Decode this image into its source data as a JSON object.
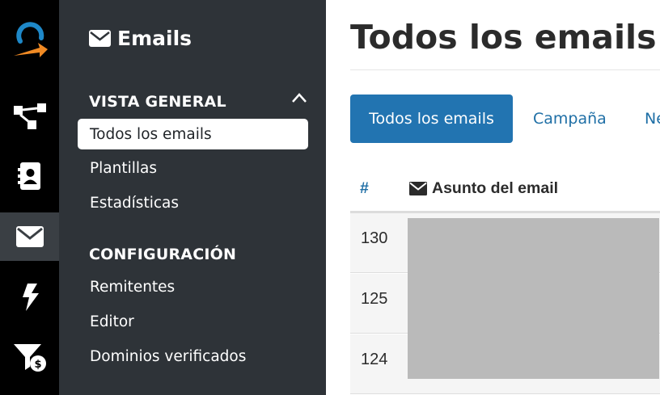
{
  "rail": {
    "items": [
      {
        "name": "logo-icon",
        "active": false
      },
      {
        "name": "workflow-icon",
        "active": false
      },
      {
        "name": "contacts-icon",
        "active": false
      },
      {
        "name": "envelope-icon",
        "active": true
      },
      {
        "name": "lightning-icon",
        "active": false
      },
      {
        "name": "funnel-dollar-icon",
        "active": false
      }
    ],
    "logo_colors": {
      "ring": "#1e88c8",
      "arrow": "#f08a24"
    }
  },
  "sidebar": {
    "title": "Emails",
    "title_icon": "envelope-icon",
    "sections": [
      {
        "label": "VISTA GENERAL",
        "collapse_icon": "chevron-up-icon",
        "items": [
          {
            "label": "Todos los emails",
            "active": true
          },
          {
            "label": "Plantillas",
            "active": false
          },
          {
            "label": "Estadísticas",
            "active": false
          }
        ]
      },
      {
        "label": "CONFIGURACIÓN",
        "items": [
          {
            "label": "Remitentes",
            "active": false
          },
          {
            "label": "Editor",
            "active": false
          },
          {
            "label": "Dominios verificados",
            "active": false
          }
        ]
      }
    ]
  },
  "main": {
    "title": "Todos los emails",
    "tabs": [
      {
        "label": "Todos los emails",
        "active": true
      },
      {
        "label": "Campaña",
        "active": false
      },
      {
        "label": "Ne",
        "active": false
      }
    ],
    "table": {
      "columns": [
        {
          "label": "#"
        },
        {
          "label": "Asunto del email",
          "icon": "envelope-icon"
        }
      ],
      "rows": [
        {
          "id": "130"
        },
        {
          "id": "125"
        },
        {
          "id": "124"
        }
      ]
    }
  },
  "colors": {
    "accent": "#2274b1",
    "link": "#1f6fa6",
    "rail_bg": "#000000",
    "sidebar_bg": "#2e3338",
    "redaction": "#bababa"
  }
}
